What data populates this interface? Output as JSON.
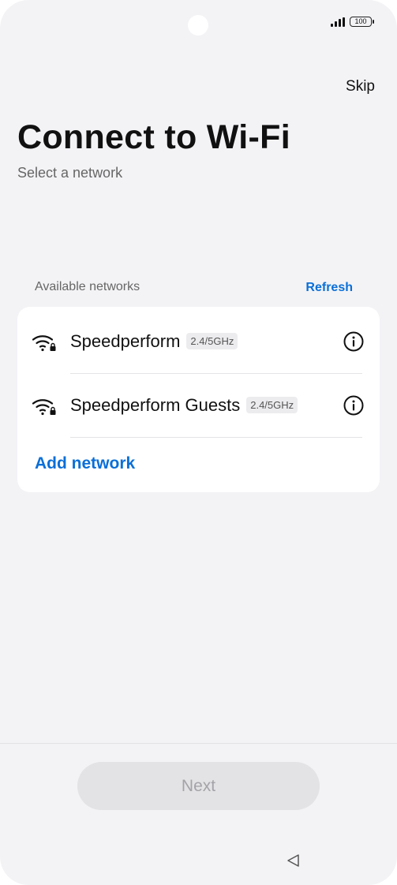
{
  "status_bar": {
    "battery_level": "100"
  },
  "header": {
    "skip_label": "Skip",
    "title": "Connect to Wi-Fi",
    "subtitle": "Select a network"
  },
  "networks_section": {
    "label": "Available networks",
    "refresh_label": "Refresh",
    "networks": [
      {
        "name": "Speedperform",
        "band": "2.4/5GHz",
        "icon": "wifi-locked-icon"
      },
      {
        "name": "Speedperform Guests",
        "band": "2.4/5GHz",
        "icon": "wifi-locked-icon"
      }
    ],
    "add_network_label": "Add network"
  },
  "footer": {
    "next_label": "Next",
    "next_enabled": false
  },
  "nav_bar": {
    "back_icon": "back-triangle-icon"
  },
  "colors": {
    "accent": "#0a6fd8",
    "background": "#f3f3f6",
    "card": "#ffffff",
    "disabled_button": "#e3e3e6"
  }
}
